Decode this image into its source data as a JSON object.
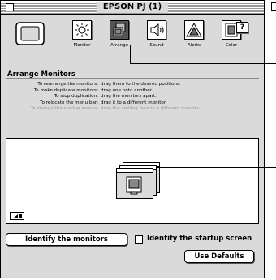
{
  "window": {
    "title": "EPSON PJ   (1)"
  },
  "toolbar": {
    "items": [
      {
        "label": "Monitor",
        "icon": "sun-icon"
      },
      {
        "label": "Arrange",
        "icon": "arrange-icon",
        "selected": true
      },
      {
        "label": "Sound",
        "icon": "speaker-icon"
      },
      {
        "label": "Alerts",
        "icon": "alert-triangle-icon"
      },
      {
        "label": "Color",
        "icon": "color-icon"
      }
    ],
    "help_label": "?"
  },
  "group": {
    "title": "Arrange Monitors",
    "instructions": [
      {
        "label": "To rearrange the monitors:",
        "text": "drag them to the desired positions.",
        "dim": false
      },
      {
        "label": "To make duplicate monitors:",
        "text": "drag one onto another.",
        "dim": false
      },
      {
        "label": "To stop duplication:",
        "text": "drag the monitors apart.",
        "dim": false
      },
      {
        "label": "To relocate the menu bar:",
        "text": "drag it to a different monitor.",
        "dim": false
      },
      {
        "label": "To change the startup screen:",
        "text": "drag the smiling face to a different monitor.",
        "dim": true
      }
    ]
  },
  "buttons": {
    "identify_monitors": "Identify the monitors",
    "identify_startup": "Identify the startup screen",
    "use_defaults": "Use Defaults"
  },
  "colors": {
    "window_bg": "#dadada",
    "selected_tool": "#555555"
  }
}
